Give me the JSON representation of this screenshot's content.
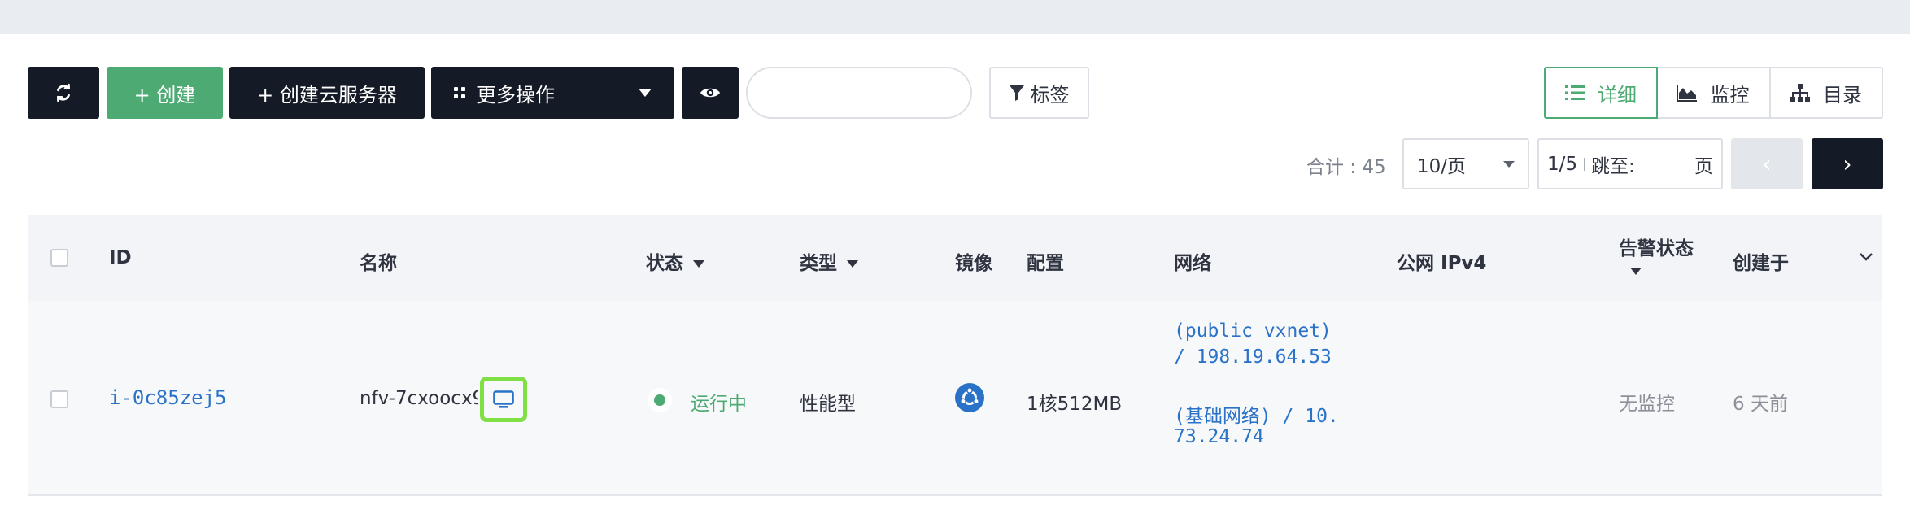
{
  "toolbar": {
    "refresh_icon": "refresh-icon",
    "create_label": "+ 创建",
    "create_server_label": "+ 创建云服务器",
    "more_ops_label": "更多操作",
    "tags_label": "标签"
  },
  "search": {
    "value": "",
    "placeholder": ""
  },
  "views": {
    "detail": "详细",
    "monitor": "监控",
    "directory": "目录"
  },
  "pagination": {
    "total": "合计 : 45",
    "per_page": "10/页",
    "page": "1/5",
    "jump_label": "跳至:",
    "page_unit": "页",
    "prev": "‹",
    "next": "›"
  },
  "table": {
    "headers": {
      "id": "ID",
      "name": "名称",
      "status": "状态",
      "type": "类型",
      "image": "镜像",
      "config": "配置",
      "network": "网络",
      "public_ip": "公网 IPv4",
      "alarm_status": "告警状态",
      "created": "创建于"
    },
    "rows": [
      {
        "id": "i-0c85zej5",
        "name": "nfv-7cxoocx9",
        "status": "运行中",
        "type": "性能型",
        "image_icon": "ubuntu-icon",
        "config": "1核512MB",
        "network_line1": "(public vxnet)",
        "network_line2": "/ 198.19.64.53",
        "network_line3": "(基础网络) / 10.",
        "network_line4": "73.24.74",
        "public_ip": "",
        "alarm": "无监控",
        "created": "6 天前"
      }
    ]
  },
  "colors": {
    "accent": "#4caa72",
    "dark": "#151b26",
    "link": "#2a72c8",
    "highlight": "#7ee045"
  }
}
